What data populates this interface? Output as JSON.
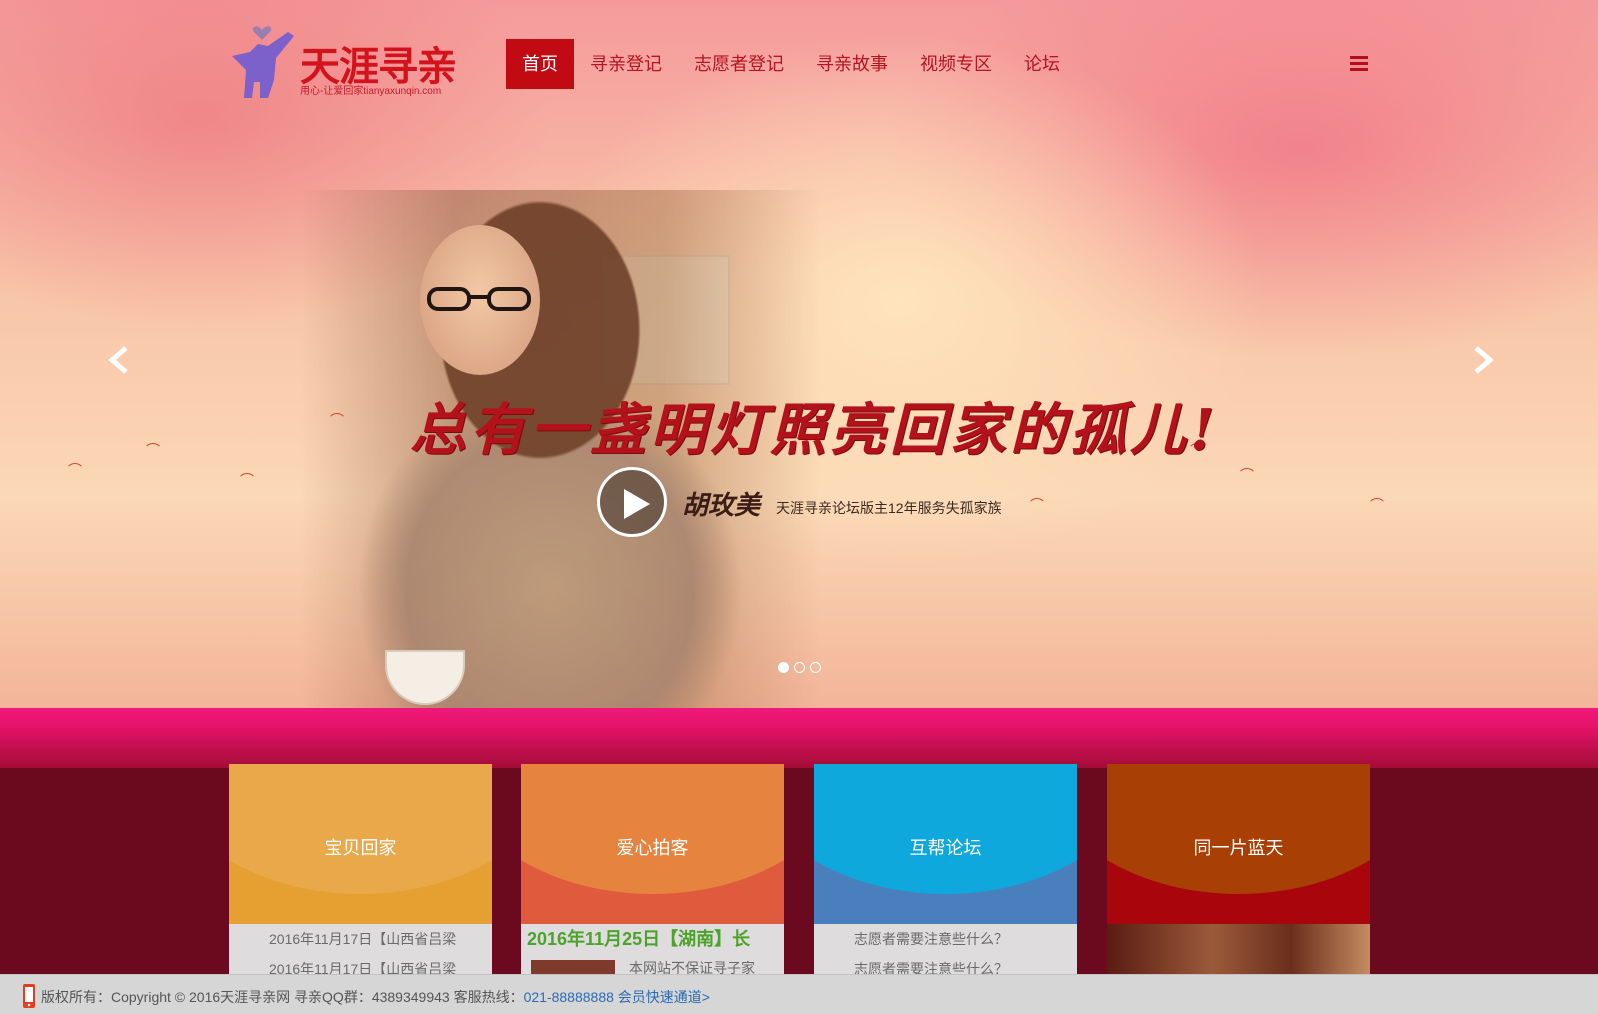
{
  "brand": {
    "name": "天涯寻亲",
    "tagline": "用心-让爱回家tianyaxunqin.com",
    "primary_color": "#c10a12"
  },
  "nav": {
    "items": [
      {
        "label": "首页",
        "active": true
      },
      {
        "label": "寻亲登记",
        "active": false
      },
      {
        "label": "志愿者登记",
        "active": false
      },
      {
        "label": "寻亲故事",
        "active": false
      },
      {
        "label": "视频专区",
        "active": false
      },
      {
        "label": "论坛",
        "active": false
      }
    ],
    "menu_icon": "hamburger-icon"
  },
  "hero": {
    "slogan": "总有一盏明灯照亮回家的孤儿!",
    "speaker_name": "胡玫美",
    "speaker_desc": "天涯寻亲论坛版主12年服务失孤家族",
    "slide_count": 3,
    "active_slide": 1
  },
  "cards": [
    {
      "title": "宝贝回家",
      "color_top": "#e9a84a",
      "color_bottom": "#e6a031",
      "lines": [
        "2016年11月17日【山西省吕梁",
        "2016年11月17日【山西省吕梁"
      ]
    },
    {
      "title": "爱心拍客",
      "color_top": "#e6843f",
      "color_bottom": "#e05a3d",
      "headline": "2016年11月25日【湖南】长",
      "sub": "本网站不保证寻子家"
    },
    {
      "title": "互帮论坛",
      "color_top": "#0ea8dc",
      "color_bottom": "#4a7fbd",
      "lines": [
        "志愿者需要注意些什么？",
        "志愿者需要注意些什么？"
      ]
    },
    {
      "title": "同一片蓝天",
      "color_top": "#a83f05",
      "color_bottom": "#a8050d"
    }
  ],
  "footer": {
    "text": "版权所有：Copyright © 2016天涯寻亲网 寻亲QQ群：4389349943 客服热线：",
    "hotline": "021-88888888",
    "quick_link": "会员快速通道>"
  }
}
